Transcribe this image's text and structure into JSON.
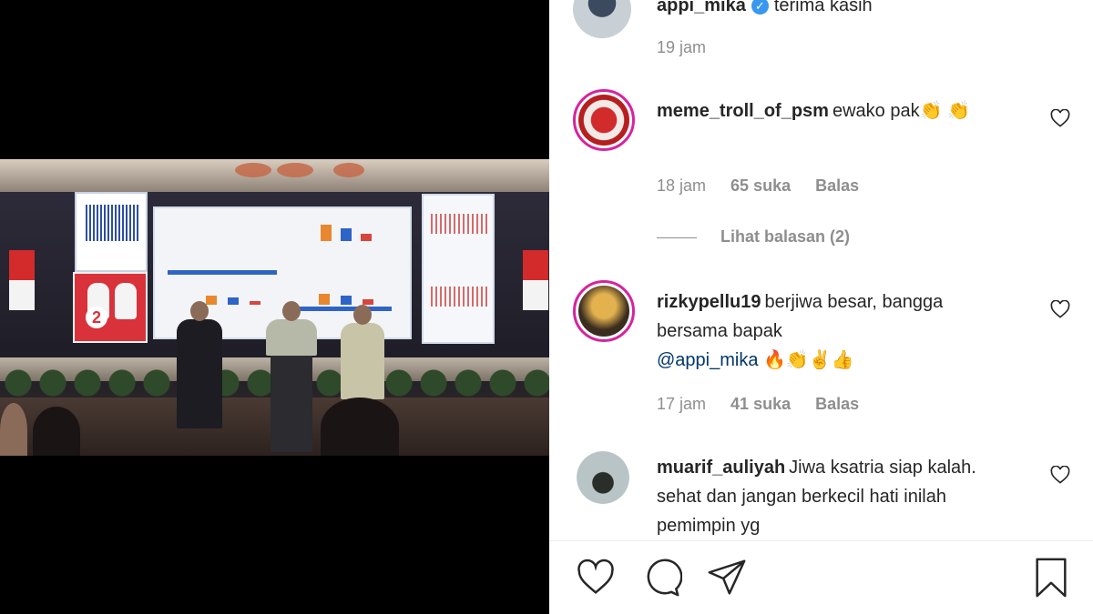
{
  "comments": [
    {
      "username": "appi_mika",
      "text": "terima kasih",
      "verified": true,
      "time": "19 jam"
    },
    {
      "username": "meme_troll_of_psm",
      "text": "ewako pak👏 👏",
      "time": "18 jam",
      "likes": "65 suka",
      "reply_label": "Balas",
      "view_replies": "Lihat balasan (2)"
    },
    {
      "username": "rizkypellu19",
      "text": "berjiwa besar, bangga bersama bapak",
      "mention": "@appi_mika",
      "emoji": "🔥👏✌👍",
      "time": "17 jam",
      "likes": "41 suka",
      "reply_label": "Balas"
    },
    {
      "username": "muarif_auliyah",
      "text": "Jiwa ksatria siap kalah. sehat dan jangan berkecil hati inilah pemimpin yg"
    }
  ],
  "poster_number": "2",
  "icons": {
    "like": "heart-icon",
    "comment": "comment-icon",
    "share": "share-icon",
    "save": "bookmark-icon",
    "comment_like": "heart-outline-icon"
  },
  "colors": {
    "text": "#262626",
    "meta": "#8e8e8e",
    "mention": "#00376b",
    "verified": "#3897f0",
    "story_ring": "#d6249f"
  }
}
